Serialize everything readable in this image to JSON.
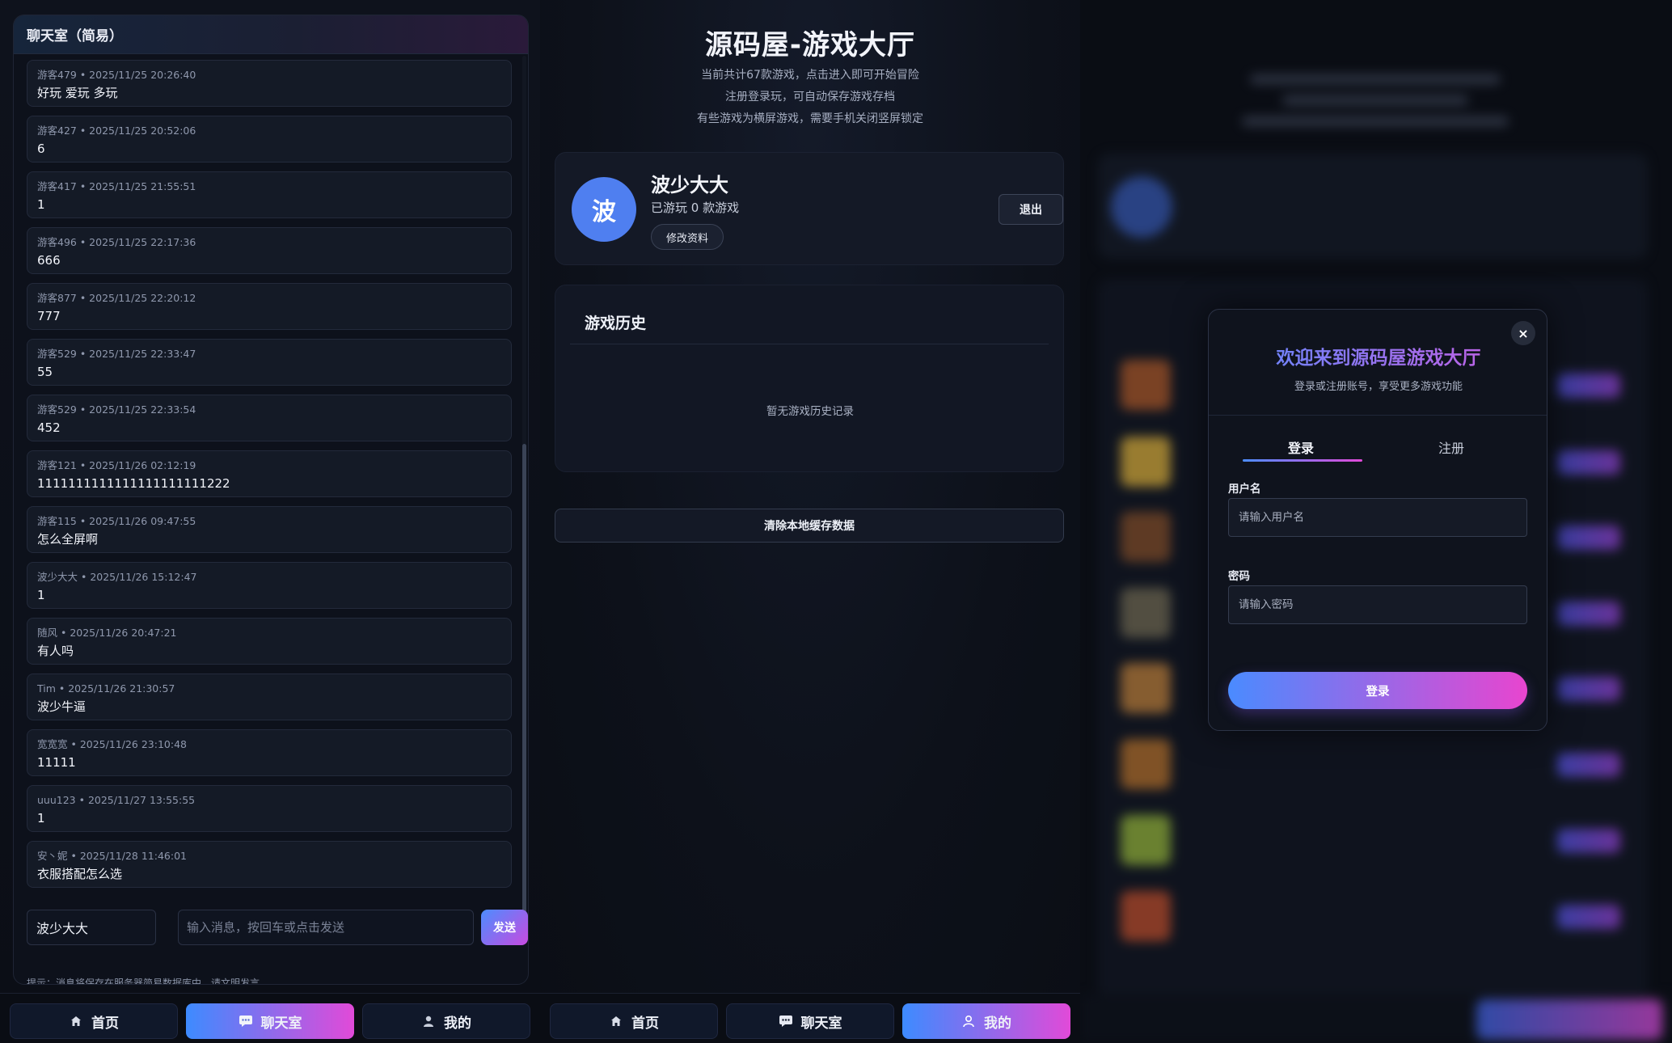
{
  "chat": {
    "title": "聊天室（简易）",
    "messages": [
      {
        "meta": "游客479 • 2025/11/25 20:26:40",
        "text": "好玩 爱玩 多玩"
      },
      {
        "meta": "游客427 • 2025/11/25 20:52:06",
        "text": "6"
      },
      {
        "meta": "游客417 • 2025/11/25 21:55:51",
        "text": "1"
      },
      {
        "meta": "游客496 • 2025/11/25 22:17:36",
        "text": "666"
      },
      {
        "meta": "游客877 • 2025/11/25 22:20:12",
        "text": "777"
      },
      {
        "meta": "游客529 • 2025/11/25 22:33:47",
        "text": "55"
      },
      {
        "meta": "游客529 • 2025/11/25 22:33:54",
        "text": "452"
      },
      {
        "meta": "游客121 • 2025/11/26 02:12:19",
        "text": "1111111111111111111111222"
      },
      {
        "meta": "游客115 • 2025/11/26 09:47:55",
        "text": "怎么全屏啊"
      },
      {
        "meta": "波少大大 • 2025/11/26 15:12:47",
        "text": "1"
      },
      {
        "meta": "随风 • 2025/11/26 20:47:21",
        "text": "有人吗"
      },
      {
        "meta": "Tim • 2025/11/26 21:30:57",
        "text": "波少牛逼"
      },
      {
        "meta": "宽宽宽 • 2025/11/26 23:10:48",
        "text": "11111"
      },
      {
        "meta": "uuu123 • 2025/11/27 13:55:55",
        "text": "1"
      },
      {
        "meta": "安丶妮 • 2025/11/28 11:46:01",
        "text": "衣服搭配怎么选"
      }
    ],
    "name_value": "波少大大",
    "input_placeholder": "输入消息，按回车或点击发送",
    "send_label": "发送",
    "tip": "提示：消息将保存在服务器简易数据库中，请文明发言。"
  },
  "nav_left": {
    "home": "首页",
    "chat": "聊天室",
    "mine": "我的"
  },
  "nav_mid": {
    "home": "首页",
    "chat": "聊天室",
    "mine": "我的"
  },
  "hall": {
    "title": "源码屋-游戏大厅",
    "sub1": "当前共计67款游戏，点击进入即可开始冒险",
    "sub2": "注册登录玩，可自动保存游戏存档",
    "sub3": "有些游戏为横屏游戏，需要手机关闭竖屏锁定"
  },
  "profile": {
    "avatar_char": "波",
    "name": "波少大大",
    "played": "已游玩 0 款游戏",
    "edit_label": "修改资料",
    "logout_label": "退出"
  },
  "history": {
    "title": "游戏历史",
    "empty": "暂无游戏历史记录"
  },
  "clear_label": "清除本地缓存数据",
  "login_modal": {
    "close": "×",
    "title": "欢迎来到源码屋游戏大厅",
    "subtitle": "登录或注册账号，享受更多游戏功能",
    "tab_login": "登录",
    "tab_register": "注册",
    "username_label": "用户名",
    "username_placeholder": "请输入用户名",
    "password_label": "密码",
    "password_placeholder": "请输入密码",
    "submit_label": "登录"
  },
  "colors": {
    "accent_start": "#4c8dff",
    "accent_end": "#e14ad8",
    "avatar": "#4f7ff0"
  },
  "icons": {
    "home": "home-icon",
    "chat": "chat-icon",
    "user": "user-icon",
    "close": "close-icon"
  }
}
